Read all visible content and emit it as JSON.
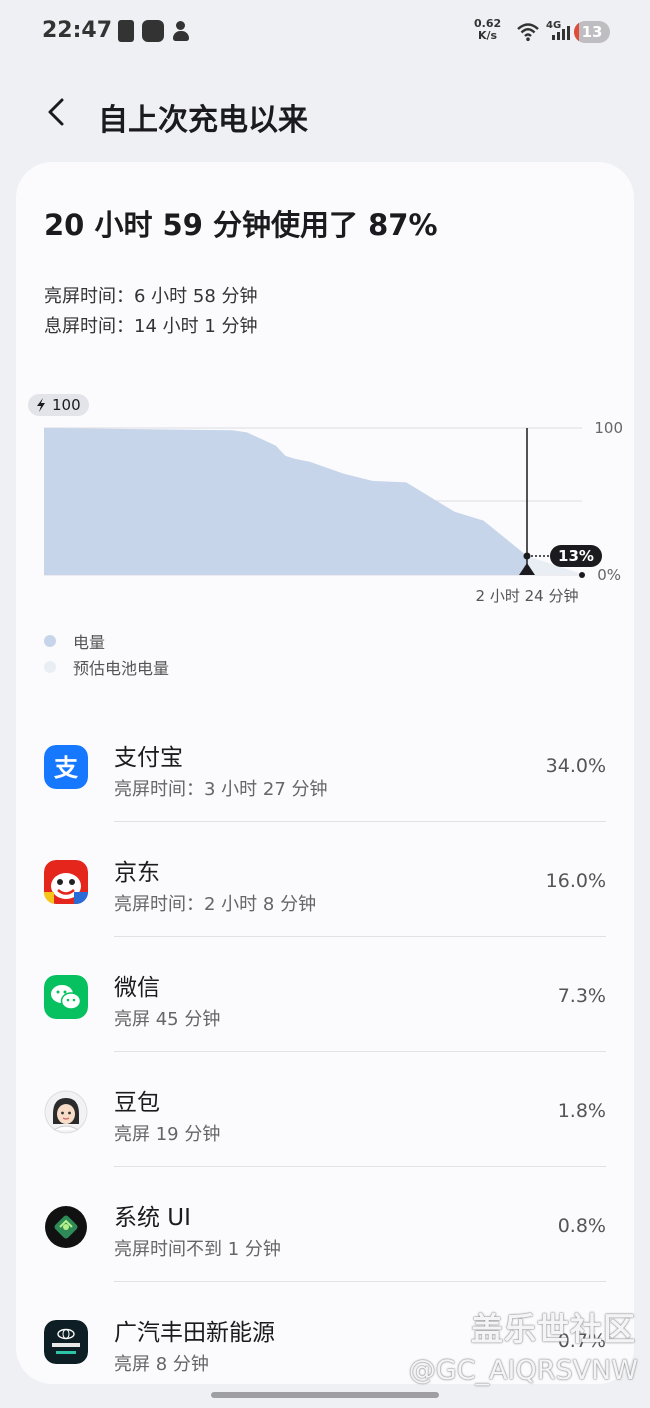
{
  "status_bar": {
    "time": "22:47",
    "net_speed": "0.62",
    "net_unit": "K/s",
    "network_type": "4G",
    "battery": "13",
    "icons": [
      "battery-alert-icon",
      "app-notification-icon",
      "person-icon",
      "wifi-icon",
      "signal-icon"
    ]
  },
  "header": {
    "title": "自上次充电以来",
    "back_icon": "back-arrow-icon"
  },
  "summary": {
    "headline": "20 小时 59 分钟使用了 87%",
    "screen_on": "亮屏时间：6 小时 58 分钟",
    "screen_off": "息屏时间：14 小时 1 分钟"
  },
  "chart_data": {
    "type": "area",
    "ylim": [
      0,
      100
    ],
    "y_ticks": [
      "100",
      "0%"
    ],
    "start_badge": "100",
    "current_badge": "13%",
    "time_label": "2 小时 24 分钟",
    "colors": {
      "battery": "#c6d5e9",
      "estimate": "#e9eef5"
    },
    "series": [
      {
        "name": "电量",
        "x": [
          0,
          0.39,
          0.42,
          0.48,
          0.5,
          0.52,
          0.55,
          0.62,
          0.68,
          0.75,
          0.85,
          0.91,
          1.0
        ],
        "values": [
          100,
          98.5,
          97,
          88,
          81,
          79,
          77,
          69,
          64,
          63,
          43,
          37,
          13
        ]
      },
      {
        "name": "预估电池电量",
        "x": [
          1.0,
          1.12
        ],
        "values": [
          13,
          0
        ]
      }
    ]
  },
  "legend": [
    {
      "label": "电量",
      "color": "#c6d5e9"
    },
    {
      "label": "预估电池电量",
      "color": "#e9eef5"
    }
  ],
  "apps": [
    {
      "name": "支付宝",
      "sub": "亮屏时间：3 小时 27 分钟",
      "pct": "34.0%",
      "icon": "alipay-icon"
    },
    {
      "name": "京东",
      "sub": "亮屏时间：2 小时 8 分钟",
      "pct": "16.0%",
      "icon": "jd-icon"
    },
    {
      "name": "微信",
      "sub": "亮屏 45 分钟",
      "pct": "7.3%",
      "icon": "wechat-icon"
    },
    {
      "name": "豆包",
      "sub": "亮屏 19 分钟",
      "pct": "1.8%",
      "icon": "doubao-icon"
    },
    {
      "name": "系统 UI",
      "sub": "亮屏时间不到 1 分钟",
      "pct": "0.8%",
      "icon": "system-ui-icon"
    },
    {
      "name": "广汽丰田新能源",
      "sub": "亮屏 8 分钟",
      "pct": "0.7%",
      "icon": "gac-toyota-icon"
    }
  ],
  "watermark": {
    "site": "盖乐世社区",
    "user": "@GC_AIQRSVNW"
  }
}
